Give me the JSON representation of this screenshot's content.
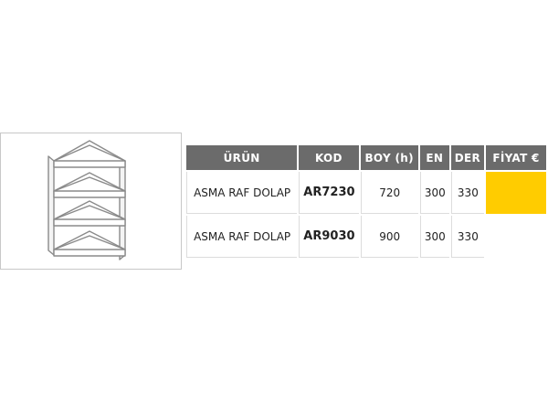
{
  "table": {
    "headers": {
      "urun": "ÜRÜN",
      "kod": "KOD",
      "boy": "BOY (h)",
      "en": "EN",
      "der": "DER",
      "fiyat": "FİYAT €"
    },
    "rows": [
      {
        "urun": "ASMA RAF DOLAP",
        "kod": "AR7230",
        "boy": "720",
        "en": "300",
        "der": "330",
        "fiyat": "",
        "highlighted": true
      },
      {
        "urun": "ASMA RAF DOLAP",
        "kod": "AR9030",
        "boy": "900",
        "en": "300",
        "der": "330",
        "fiyat": "",
        "highlighted": false
      }
    ]
  },
  "colors": {
    "header_bg": "#6b6b6b",
    "price_highlight": "#ffcc00"
  },
  "product_image": {
    "icon": "corner-shelf-cabinet-icon"
  }
}
